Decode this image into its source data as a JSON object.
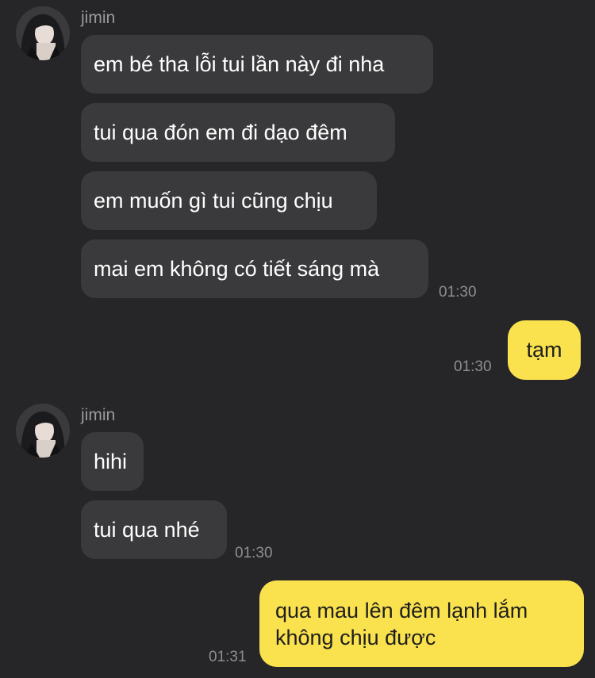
{
  "groups": [
    {
      "sender": "jimin",
      "avatar_icon": "profile-photo-avatar",
      "messages": [
        {
          "text": "em bé tha lỗi tui lần này đi nha"
        },
        {
          "text": "tui qua đón em đi dạo đêm"
        },
        {
          "text": "em muốn gì tui cũng chịu"
        },
        {
          "text": "mai em không có tiết sáng mà",
          "time": "01:30"
        }
      ]
    },
    {
      "outgoing": true,
      "messages": [
        {
          "text": "tạm",
          "time": "01:30"
        }
      ]
    },
    {
      "sender": "jimin",
      "avatar_icon": "profile-photo-avatar",
      "messages": [
        {
          "text": "hihi"
        },
        {
          "text": "tui qua nhé",
          "time": "01:30"
        }
      ]
    },
    {
      "outgoing": true,
      "messages": [
        {
          "text": "qua mau lên đêm lạnh lắm\nkhông chịu được",
          "time": "01:31"
        }
      ]
    }
  ],
  "colors": {
    "background": "#262628",
    "incoming_bubble": "#3a3a3c",
    "outgoing_bubble": "#fae24e",
    "timestamp": "#8e8e92"
  }
}
